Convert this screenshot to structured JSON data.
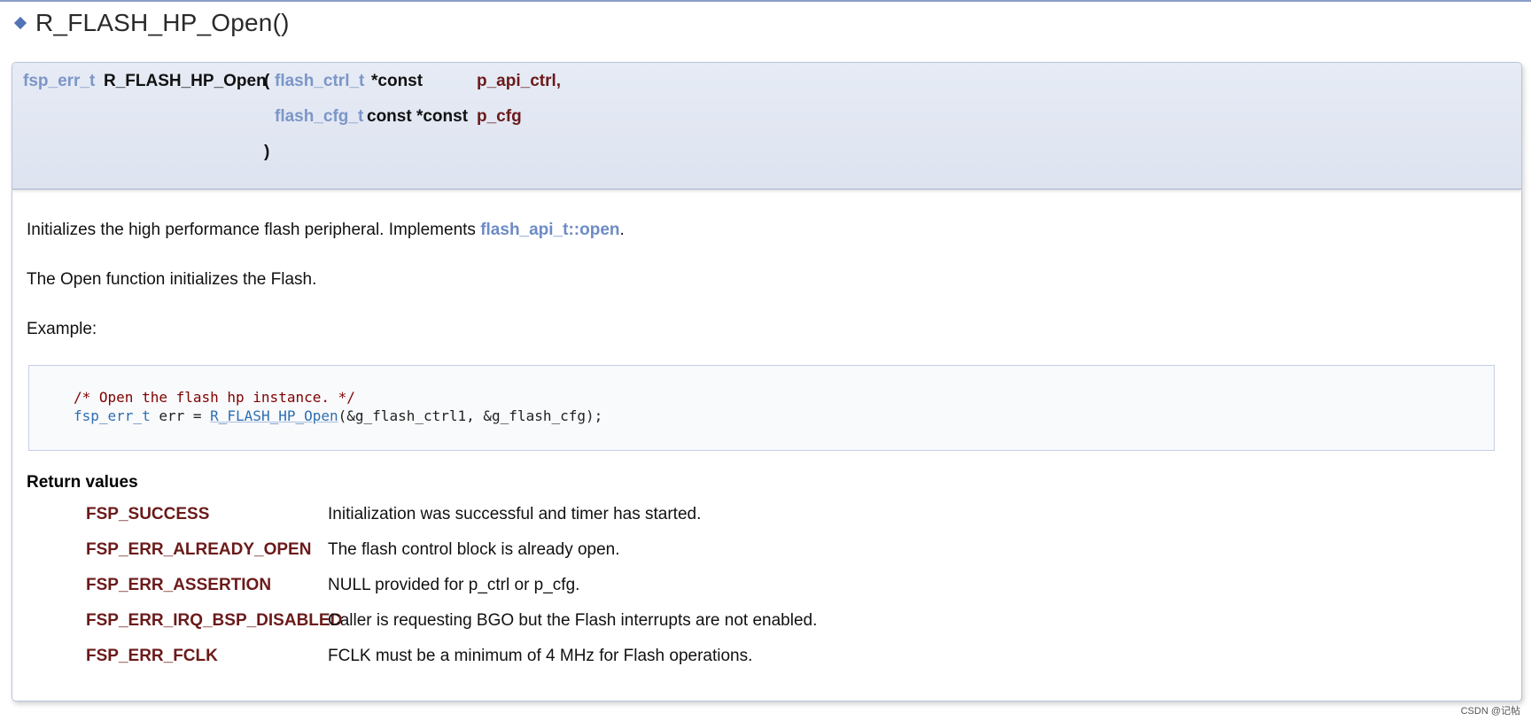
{
  "title": "R_FLASH_HP_Open()",
  "prototype": {
    "return_type": "fsp_err_t",
    "function_name": "R_FLASH_HP_Open",
    "open_paren": "(",
    "params": [
      {
        "type": "flash_ctrl_t",
        "qualifier": "*const",
        "name": "p_api_ctrl,"
      },
      {
        "type": "flash_cfg_t",
        "qualifier": "const *const",
        "name": "p_cfg"
      }
    ],
    "close_paren": ")"
  },
  "description": {
    "line1_text": "Initializes the high performance flash peripheral. Implements ",
    "line1_link": "flash_api_t::open",
    "line1_end": ".",
    "line2": "The Open function initializes the Flash.",
    "line3": "Example:"
  },
  "code": {
    "comment": "/* Open the flash hp instance. */",
    "type": "fsp_err_t",
    "var": " err = ",
    "func": "R_FLASH_HP_Open",
    "args": "(&g_flash_ctrl1, &g_flash_cfg);"
  },
  "return_values": {
    "heading": "Return values",
    "items": [
      {
        "name": "FSP_SUCCESS",
        "desc": "Initialization was successful and timer has started."
      },
      {
        "name": "FSP_ERR_ALREADY_OPEN",
        "desc": "The flash control block is already open."
      },
      {
        "name": "FSP_ERR_ASSERTION",
        "desc": "NULL provided for p_ctrl or p_cfg."
      },
      {
        "name": "FSP_ERR_IRQ_BSP_DISABLED",
        "desc": "Caller is requesting BGO but the Flash interrupts are not enabled."
      },
      {
        "name": "FSP_ERR_FCLK",
        "desc": "FCLK must be a minimum of 4 MHz for Flash operations."
      }
    ]
  },
  "watermark": "CSDN @记帖",
  "colors": {
    "type_link": "#7c96c8",
    "param_name": "#6b1a1a",
    "header_bg": "#dde3f0",
    "code_comment": "#800000"
  },
  "icons": {
    "title_marker": "diamond-icon"
  }
}
